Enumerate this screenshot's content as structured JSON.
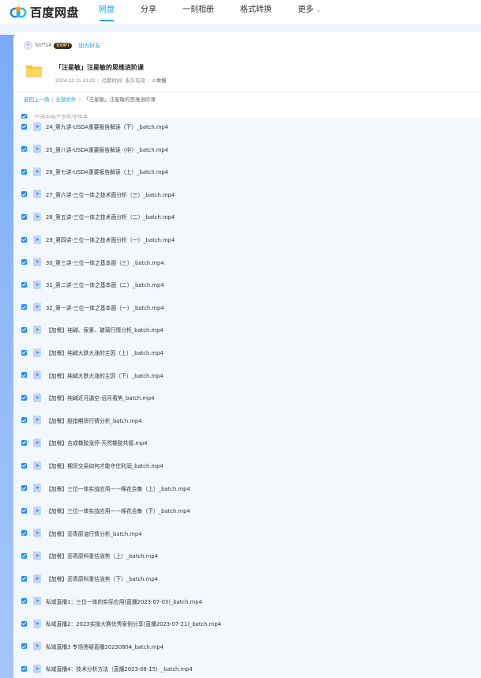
{
  "app": {
    "logo_text": "百度网盘",
    "nav": [
      {
        "label": "网盘",
        "active": true
      },
      {
        "label": "分享",
        "active": false
      },
      {
        "label": "一刻相册",
        "active": false
      },
      {
        "label": "格式转换",
        "active": false
      },
      {
        "label": "更多",
        "active": false
      }
    ],
    "accent_color": "#06a7ff"
  },
  "share": {
    "username": "ks**14",
    "vip_badge": "SVIP7",
    "add_friend": "加为好友",
    "folder_title": "「汪星敏」汪星敏的思维进阶课",
    "date": "2024-12-11 21:02",
    "expire_label": "过期时间:",
    "expire_value": "永久有效",
    "report": "举报"
  },
  "breadcrumb": {
    "back": "返回上一级",
    "all_files": "全部文件",
    "current": "「汪星敏」汪星敏的思维进阶课"
  },
  "selection": {
    "text": "已选中46个文件/文件夹"
  },
  "files": [
    {
      "name": "24_第九讲-USDA重要报告解读（下）_batch.mp4"
    },
    {
      "name": "25_第八讲-USDA重要报告解读（中）_batch.mp4"
    },
    {
      "name": "26_第七讲-USDA重要报告解读（上）_batch.mp4"
    },
    {
      "name": "27_第六讲-三位一体之技术面分析（三）_batch.mp4"
    },
    {
      "name": "28_第五讲-三位一体之技术面分析（二）_batch.mp4"
    },
    {
      "name": "29_第四讲-三位一体之技术面分析（一）_batch.mp4"
    },
    {
      "name": "30_第三讲-三位一体之基本面（三）_batch.mp4"
    },
    {
      "name": "31_第二讲-三位一体之基本面（二）_batch.mp4"
    },
    {
      "name": "32_第一讲-三位一体之基本面（一）_batch.mp4"
    },
    {
      "name": "【加餐】纯碱、尿素、玻璃行情分析_batch.mp4"
    },
    {
      "name": "【加餐】纯碱大跌大涨的主因（上）_batch.mp4"
    },
    {
      "name": "【加餐】纯碱大跌大涨的主因（下）_batch.mp4"
    },
    {
      "name": "【加餐】纯碱近月逼空-远月看势_batch.mp4"
    },
    {
      "name": "【加餐】股指期货行情分析_batch.mp4"
    },
    {
      "name": "【加餐】合成橡胶涨停-天然橡胶共振.mp4"
    },
    {
      "name": "【加餐】期货交易如何才能守住利润_batch.mp4"
    },
    {
      "name": "【加餐】三位一体实战应用——棉花合集（上）_batch.mp4"
    },
    {
      "name": "【加餐】三位一体实战应用——棉花合集（下）_batch.mp4"
    },
    {
      "name": "【加餐】沥青原油行情分析_batch.mp4"
    },
    {
      "name": "【加餐】沥青原料重估涨势（上）_batch.mp4"
    },
    {
      "name": "【加餐】沥青原料重估涨势（下）_batch.mp4"
    },
    {
      "name": "私域直播1：三位一体的实际应用(直播2023-07-03)_batch.mp4"
    },
    {
      "name": "私域直播2：2023实操大赛优秀案例分享(直播2023-07-21)_batch.mp4"
    },
    {
      "name": "私域直播3 专场答疑直播20230804_batch.mp4"
    },
    {
      "name": "私域直播4：技术分析方法（直播2023-08-15）_batch.mp4"
    }
  ]
}
